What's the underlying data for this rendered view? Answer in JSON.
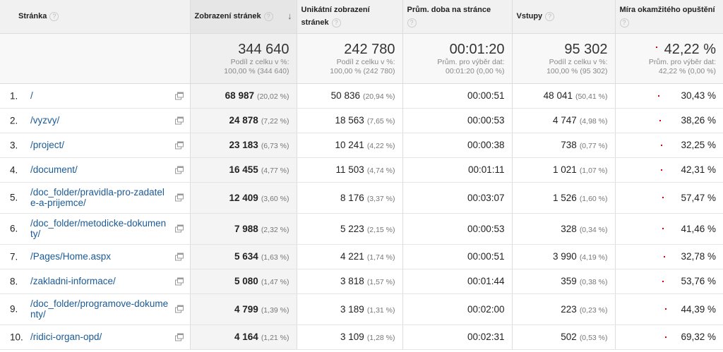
{
  "headers": {
    "page": "Stránka",
    "pageviews": "Zobrazení stránek",
    "unique_pageviews_1": "Unikátní zobrazení",
    "unique_pageviews_2": "stránek",
    "avg_time": "Prům. doba na stránce",
    "entrances": "Vstupy",
    "bounce_rate": "Míra okamžitého opuštění",
    "help_icon": "?",
    "sort_arrow": "↓"
  },
  "totals": {
    "pageviews": {
      "value": "344 640",
      "sub1": "Podíl z celku v %:",
      "sub2": "100,00 % (344 640)"
    },
    "unique_pageviews": {
      "value": "242 780",
      "sub1": "Podíl z celku v %:",
      "sub2": "100,00 % (242 780)"
    },
    "avg_time": {
      "value": "00:01:20",
      "sub1": "Prům. pro výběr dat:",
      "sub2": "00:01:20 (0,00 %)"
    },
    "entrances": {
      "value": "95 302",
      "sub1": "Podíl z celku v %:",
      "sub2": "100,00 % (95 302)"
    },
    "bounce_rate": {
      "value": "42,22 %",
      "sub1": "Prům. pro výběr dat:",
      "sub2": "42,22 % (0,00 %)"
    }
  },
  "rows": [
    {
      "num": "1.",
      "page": "/",
      "views": "68 987",
      "views_pct": "(20,02 %)",
      "uniq": "50 836",
      "uniq_pct": "(20,94 %)",
      "time": "00:00:51",
      "ent": "48 041",
      "ent_pct": "(50,41 %)",
      "bounce": "30,43 %"
    },
    {
      "num": "2.",
      "page": "/vyzvy/",
      "views": "24 878",
      "views_pct": "(7,22 %)",
      "uniq": "18 563",
      "uniq_pct": "(7,65 %)",
      "time": "00:00:53",
      "ent": "4 747",
      "ent_pct": "(4,98 %)",
      "bounce": "38,26 %"
    },
    {
      "num": "3.",
      "page": "/project/",
      "views": "23 183",
      "views_pct": "(6,73 %)",
      "uniq": "10 241",
      "uniq_pct": "(4,22 %)",
      "time": "00:00:38",
      "ent": "738",
      "ent_pct": "(0,77 %)",
      "bounce": "32,25 %"
    },
    {
      "num": "4.",
      "page": "/document/",
      "views": "16 455",
      "views_pct": "(4,77 %)",
      "uniq": "11 503",
      "uniq_pct": "(4,74 %)",
      "time": "00:01:11",
      "ent": "1 021",
      "ent_pct": "(1,07 %)",
      "bounce": "42,31 %"
    },
    {
      "num": "5.",
      "page": "/doc_folder/pravidla-pro-zadatele-a-prijemce/",
      "views": "12 409",
      "views_pct": "(3,60 %)",
      "uniq": "8 176",
      "uniq_pct": "(3,37 %)",
      "time": "00:03:07",
      "ent": "1 526",
      "ent_pct": "(1,60 %)",
      "bounce": "57,47 %"
    },
    {
      "num": "6.",
      "page": "/doc_folder/metodicke-dokumenty/",
      "views": "7 988",
      "views_pct": "(2,32 %)",
      "uniq": "5 223",
      "uniq_pct": "(2,15 %)",
      "time": "00:00:53",
      "ent": "328",
      "ent_pct": "(0,34 %)",
      "bounce": "41,46 %"
    },
    {
      "num": "7.",
      "page": "/Pages/Home.aspx",
      "views": "5 634",
      "views_pct": "(1,63 %)",
      "uniq": "4 221",
      "uniq_pct": "(1,74 %)",
      "time": "00:00:51",
      "ent": "3 990",
      "ent_pct": "(4,19 %)",
      "bounce": "32,78 %"
    },
    {
      "num": "8.",
      "page": "/zakladni-informace/",
      "views": "5 080",
      "views_pct": "(1,47 %)",
      "uniq": "3 818",
      "uniq_pct": "(1,57 %)",
      "time": "00:01:44",
      "ent": "359",
      "ent_pct": "(0,38 %)",
      "bounce": "53,76 %"
    },
    {
      "num": "9.",
      "page": "/doc_folder/programove-dokumenty/",
      "views": "4 799",
      "views_pct": "(1,39 %)",
      "uniq": "3 189",
      "uniq_pct": "(1,31 %)",
      "time": "00:02:00",
      "ent": "223",
      "ent_pct": "(0,23 %)",
      "bounce": "44,39 %"
    },
    {
      "num": "10.",
      "page": "/ridici-organ-opd/",
      "views": "4 164",
      "views_pct": "(1,21 %)",
      "uniq": "3 109",
      "uniq_pct": "(1,28 %)",
      "time": "00:02:31",
      "ent": "502",
      "ent_pct": "(0,53 %)",
      "bounce": "69,32 %"
    }
  ],
  "colors": {
    "link": "#1a5a96",
    "indicator": "#dd0000"
  }
}
